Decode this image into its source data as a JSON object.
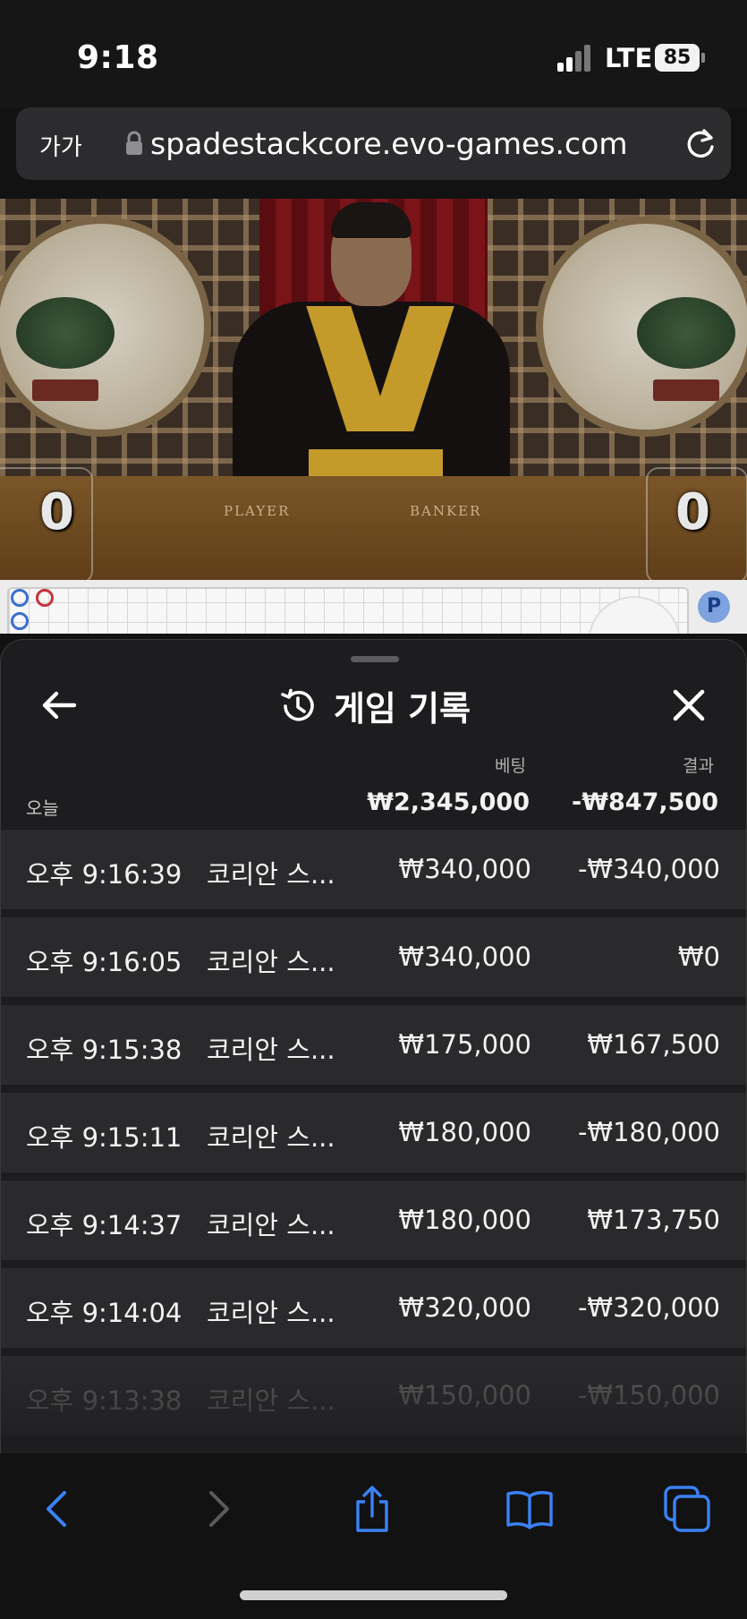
{
  "status_bar": {
    "time": "9:18",
    "network": "LTE",
    "battery": "85"
  },
  "browser": {
    "text_size_label": "가가",
    "url": "spadestackcore.evo-games.com"
  },
  "video": {
    "player_label": "PLAYER",
    "banker_label": "BANKER",
    "player_score": "0",
    "banker_score": "0"
  },
  "road": {
    "badge": "P"
  },
  "panel": {
    "title": "게임 기록",
    "col_bet": "베팅",
    "col_result": "결과",
    "today_label": "오늘",
    "today_bet_total": "₩2,345,000",
    "today_result_total": "-₩847,500",
    "rows": [
      {
        "time": "오후 9:16:39",
        "game": "코리안 스...",
        "bet": "₩340,000",
        "result": "-₩340,000"
      },
      {
        "time": "오후 9:16:05",
        "game": "코리안 스...",
        "bet": "₩340,000",
        "result": "₩0"
      },
      {
        "time": "오후 9:15:38",
        "game": "코리안 스...",
        "bet": "₩175,000",
        "result": "₩167,500"
      },
      {
        "time": "오후 9:15:11",
        "game": "코리안 스...",
        "bet": "₩180,000",
        "result": "-₩180,000"
      },
      {
        "time": "오후 9:14:37",
        "game": "코리안 스...",
        "bet": "₩180,000",
        "result": "₩173,750"
      },
      {
        "time": "오후 9:14:04",
        "game": "코리안 스...",
        "bet": "₩320,000",
        "result": "-₩320,000"
      },
      {
        "time": "오후 9:13:38",
        "game": "코리안 스...",
        "bet": "₩150,000",
        "result": "-₩150,000"
      }
    ]
  },
  "colors": {
    "accent": "#3b82f6",
    "player_blue": "#3a6fcf",
    "banker_red": "#c8323a",
    "panel_bg": "#1d1d1f",
    "row_bg": "#2a2a2c"
  },
  "icons": [
    "lock-icon",
    "reload-icon",
    "back-arrow-icon",
    "history-icon",
    "close-icon",
    "chevron-left-icon",
    "chevron-right-icon",
    "share-icon",
    "bookmarks-icon",
    "tabs-icon"
  ]
}
